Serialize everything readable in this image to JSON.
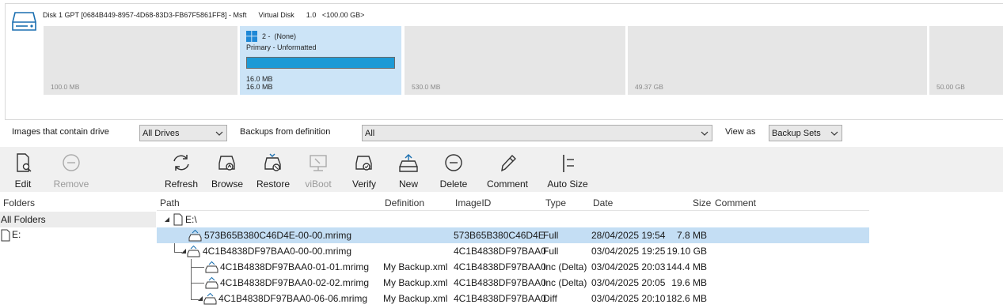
{
  "disk": {
    "title": "Disk 1 GPT [0684B449-8957-4D68-83D3-FB67F5861FF8] - Msft      Virtual Disk      1.0   <100.00 GB>",
    "partitions": [
      {
        "size": "100.0 MB"
      },
      {
        "name": "2 -  (None)",
        "type": "Primary - Unformatted",
        "size1": "16.0 MB",
        "size2": "16.0 MB"
      },
      {
        "size": "530.0 MB"
      },
      {
        "size": "49.37 GB"
      },
      {
        "size": "50.00 GB"
      }
    ]
  },
  "filters": {
    "images_label": "Images that contain drive",
    "images_value": "All Drives",
    "backups_label": "Backups from definition",
    "backups_value": "All",
    "viewas_label": "View as",
    "viewas_value": "Backup Sets"
  },
  "toolbar": {
    "edit": "Edit",
    "remove": "Remove",
    "refresh": "Refresh",
    "browse": "Browse",
    "restore": "Restore",
    "viboot": "viBoot",
    "verify": "Verify",
    "new": "New",
    "delete": "Delete",
    "comment": "Comment",
    "autosize": "Auto Size"
  },
  "folders": {
    "header": "Folders",
    "all": "All Folders",
    "drive": "E:"
  },
  "columns": {
    "path": "Path",
    "definition": "Definition",
    "imageid": "ImageID",
    "type": "Type",
    "date": "Date",
    "size": "Size",
    "comment": "Comment"
  },
  "root": "E:\\",
  "rows": [
    {
      "path": "573B65B380C46D4E-00-00.mrimg",
      "definition": "",
      "imageid": "573B65B380C46D4E",
      "type": "Full",
      "date": "28/04/2025 19:54",
      "size": "7.8 MB"
    },
    {
      "path": "4C1B4838DF97BAA0-00-00.mrimg",
      "definition": "",
      "imageid": "4C1B4838DF97BAA0",
      "type": "Full",
      "date": "03/04/2025 19:25",
      "size": "19.10 GB"
    },
    {
      "path": "4C1B4838DF97BAA0-01-01.mrimg",
      "definition": "My Backup.xml",
      "imageid": "4C1B4838DF97BAA0",
      "type": "Inc (Delta)",
      "date": "03/04/2025 20:03",
      "size": "144.4 MB"
    },
    {
      "path": "4C1B4838DF97BAA0-02-02.mrimg",
      "definition": "My Backup.xml",
      "imageid": "4C1B4838DF97BAA0",
      "type": "Inc (Delta)",
      "date": "03/04/2025 20:05",
      "size": "19.6 MB"
    },
    {
      "path": "4C1B4838DF97BAA0-06-06.mrimg",
      "definition": "My Backup.xml",
      "imageid": "4C1B4838DF97BAA0",
      "type": "Diff",
      "date": "03/04/2025 20:10",
      "size": "182.6 MB"
    }
  ],
  "colors": {
    "selection": "#c4def4",
    "partition_selected": "#cce4f7",
    "usage_bar": "#1c9ad6"
  }
}
